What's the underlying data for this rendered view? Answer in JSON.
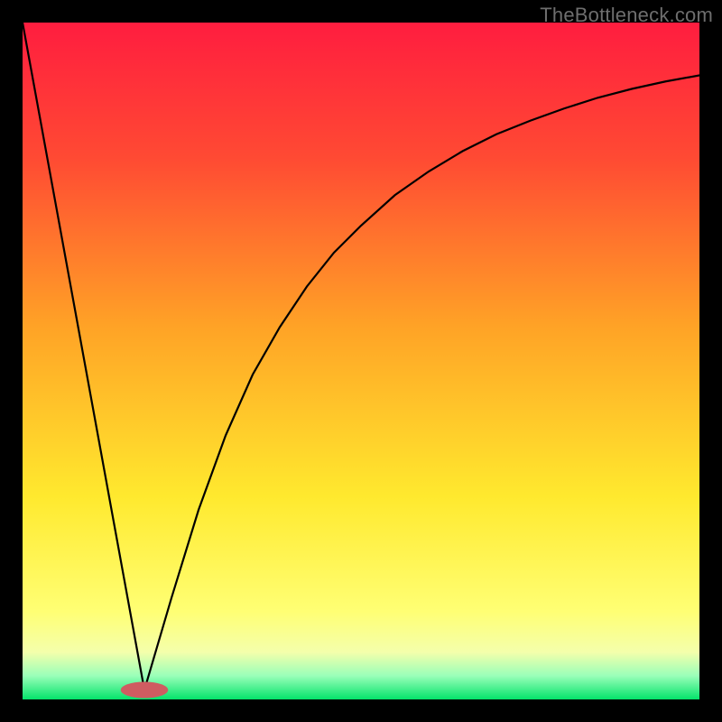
{
  "watermark": "TheBottleneck.com",
  "chart_data": {
    "type": "line",
    "title": "",
    "xlabel": "",
    "ylabel": "",
    "xlim": [
      0,
      100
    ],
    "ylim": [
      0,
      100
    ],
    "grid": false,
    "legend": false,
    "gradient_stops": [
      {
        "offset": 0.0,
        "color": "#ff1d3f"
      },
      {
        "offset": 0.2,
        "color": "#ff4a33"
      },
      {
        "offset": 0.45,
        "color": "#ffa326"
      },
      {
        "offset": 0.7,
        "color": "#ffe92e"
      },
      {
        "offset": 0.87,
        "color": "#ffff74"
      },
      {
        "offset": 0.93,
        "color": "#f4ffab"
      },
      {
        "offset": 0.965,
        "color": "#9affb9"
      },
      {
        "offset": 1.0,
        "color": "#04e36a"
      }
    ],
    "marker": {
      "x": 18,
      "y": 98.6,
      "rx": 3.5,
      "ry": 1.2,
      "fill": "#cf5c61"
    },
    "series": [
      {
        "name": "left-line",
        "x": [
          0,
          18
        ],
        "values": [
          100,
          1.4
        ]
      },
      {
        "name": "right-curve",
        "x": [
          18,
          22,
          26,
          30,
          34,
          38,
          42,
          46,
          50,
          55,
          60,
          65,
          70,
          75,
          80,
          85,
          90,
          95,
          100
        ],
        "values": [
          1.4,
          15,
          28,
          39,
          48,
          55,
          61,
          66,
          70,
          74.5,
          78,
          81,
          83.5,
          85.5,
          87.3,
          88.9,
          90.2,
          91.3,
          92.2
        ]
      }
    ]
  }
}
